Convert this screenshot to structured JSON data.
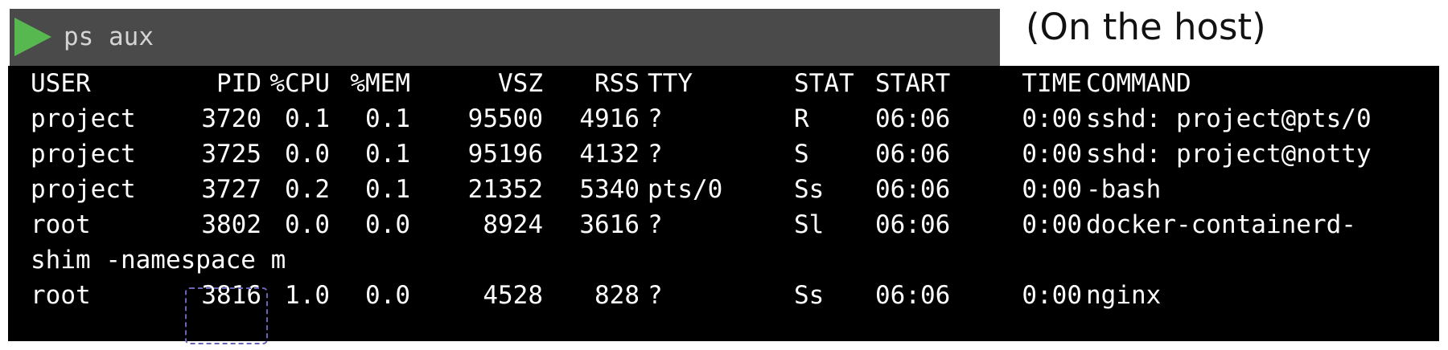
{
  "command_bar": {
    "command": "ps aux",
    "run_icon": "play-icon"
  },
  "caption": "(On the host)",
  "table": {
    "headers": [
      "USER",
      "PID",
      "%CPU",
      "%MEM",
      "VSZ",
      "RSS",
      "TTY",
      "STAT",
      "START",
      "TIME",
      "COMMAND"
    ],
    "rows": [
      {
        "user": "project",
        "pid": "3720",
        "cpu": "0.1",
        "mem": "0.1",
        "vsz": "95500",
        "rss": "4916",
        "tty": "?",
        "stat": "R",
        "start": "06:06",
        "time": "0:00",
        "command": "sshd: project@pts/0"
      },
      {
        "user": "project",
        "pid": "3725",
        "cpu": "0.0",
        "mem": "0.1",
        "vsz": "95196",
        "rss": "4132",
        "tty": "?",
        "stat": "S",
        "start": "06:06",
        "time": "0:00",
        "command": "sshd: project@notty"
      },
      {
        "user": "project",
        "pid": "3727",
        "cpu": "0.2",
        "mem": "0.1",
        "vsz": "21352",
        "rss": "5340",
        "tty": "pts/0",
        "stat": "Ss",
        "start": "06:06",
        "time": "0:00",
        "command": "-bash"
      },
      {
        "user": "root",
        "pid": "3802",
        "cpu": "0.0",
        "mem": "0.0",
        "vsz": "8924",
        "rss": "3616",
        "tty": "?",
        "stat": "Sl",
        "start": "06:06",
        "time": "0:00",
        "command": "docker-containerd-"
      },
      {
        "wrap": "shim -namespace m"
      },
      {
        "user": "root",
        "pid": "3816",
        "cpu": "1.0",
        "mem": "0.0",
        "vsz": "4528",
        "rss": "828",
        "tty": "?",
        "stat": "Ss",
        "start": "06:06",
        "time": "0:00",
        "command": "nginx"
      }
    ]
  },
  "colors": {
    "command_bar_bg": "#4a4a4a",
    "play_icon": "#57b84f",
    "terminal_bg": "#000000",
    "terminal_text": "#ffffff",
    "highlight_border": "#6a64b8"
  }
}
